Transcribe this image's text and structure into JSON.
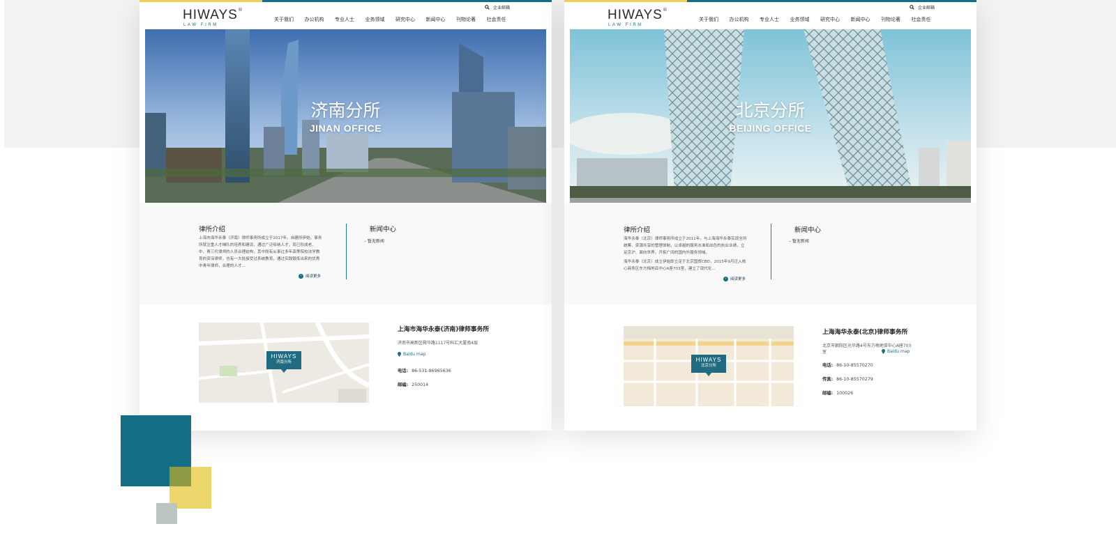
{
  "colors": {
    "accent": "#146e86",
    "yellow": "#ecd360",
    "olive": "#8f9a45",
    "grey": "#bcc4c4"
  },
  "logo": {
    "brand": "HIWAYS",
    "sub": "LAW FIRM",
    "reg": "®"
  },
  "header": {
    "mail_label": "企业邮箱",
    "icon": "search-icon"
  },
  "nav": [
    "关于我们",
    "办公机构",
    "专业人士",
    "业务领域",
    "研究中心",
    "新闻中心",
    "刊物论著",
    "社会责任"
  ],
  "jinan": {
    "hero_cn": "济南分所",
    "hero_en": "JINAN OFFICE",
    "intro_title": "律所介绍",
    "intro_text": "上海市海华永泰（济南）律师事务所成立于2017年。自建所伊始，事务所就注重人才梯队的培养和建设，通过广泛吸纳人才，现已形成老、中、青三代律师的人员合理结构，其中既有从事过多年高等院校法学教育的资深律师，也有一大批接受过系统教育，通过实践锻炼出来的优秀中青年律师，合理的人才...",
    "more": "阅读更多",
    "news_title": "新闻中心",
    "news_item": "暂无新闻",
    "map_pin_brand": "HIWAYS",
    "map_pin_label": "济南分所",
    "firm_name": "上海市海华永泰(济南)律师事务所",
    "address": "济南市高新区舜华路1117号科汇大厦南4层",
    "baidu": "Baidu map",
    "tel_label": "电话:",
    "tel": "86-531-86965636",
    "post_label": "邮编:",
    "post": "250014"
  },
  "beijing": {
    "hero_cn": "北京分所",
    "hero_en": "BEIJING OFFICE",
    "intro_title": "律所介绍",
    "intro_text_1": "海华永泰（北京）律师事务所成立于2011年。与上海海华永泰实现全所统筹、资源共享的管理体制，以卓越的服务水准和出色的执业业绩，立足京沪、面向世界，开拓广阔的国内外服务领域。",
    "intro_text_2": "海华永泰（北京）成立伊始即立足于北京国贸CBD，2015年9月迁入核心商务区东方梅地亚中心A座703室，建立了现代化...",
    "more": "阅读更多",
    "news_title": "新闻中心",
    "news_item": "暂无新闻",
    "map_pin_brand": "HIWAYS",
    "map_pin_label": "北京分所",
    "firm_name": "上海海华永泰(北京)律师事务所",
    "address": "北京市朝阳区光华路4号东方梅地亚中心A座703室",
    "baidu": "Baidu map",
    "tel_label": "电话:",
    "tel": "86-10-85570270",
    "fax_label": "传真:",
    "fax": "86-10-85570279",
    "post_label": "邮编:",
    "post": "100026"
  }
}
